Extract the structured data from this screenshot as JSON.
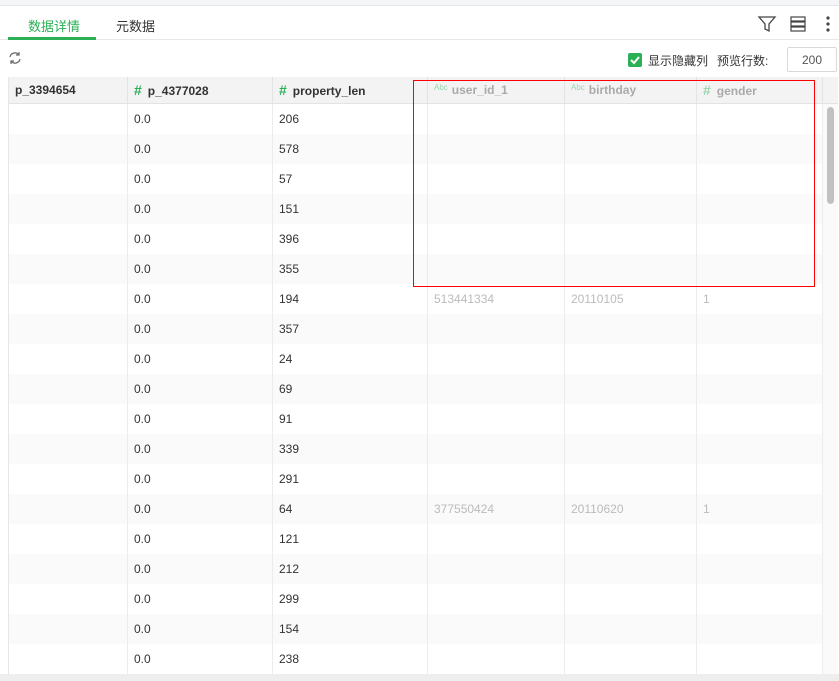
{
  "tabs": [
    {
      "label": "数据详情",
      "active": true
    },
    {
      "label": "元数据",
      "active": false
    }
  ],
  "toolbar": {
    "show_hidden_label": "显示隐藏列",
    "show_hidden_checked": true,
    "preview_rows_label": "预览行数:",
    "preview_rows_value": "200"
  },
  "columns": [
    {
      "name": "p_3394654",
      "type": "",
      "hidden": false
    },
    {
      "name": "p_4377028",
      "type": "#",
      "hidden": false
    },
    {
      "name": "property_len",
      "type": "#",
      "hidden": false
    },
    {
      "name": "user_id_1",
      "type": "Abc",
      "hidden": true
    },
    {
      "name": "birthday",
      "type": "Abc",
      "hidden": true
    },
    {
      "name": "gender",
      "type": "#",
      "hidden": true
    }
  ],
  "rows": [
    [
      "",
      "0.0",
      "206",
      "",
      "",
      ""
    ],
    [
      "",
      "0.0",
      "578",
      "",
      "",
      ""
    ],
    [
      "",
      "0.0",
      "57",
      "",
      "",
      ""
    ],
    [
      "",
      "0.0",
      "151",
      "",
      "",
      ""
    ],
    [
      "",
      "0.0",
      "396",
      "",
      "",
      ""
    ],
    [
      "",
      "0.0",
      "355",
      "",
      "",
      ""
    ],
    [
      "",
      "0.0",
      "194",
      "513441334",
      "20110105",
      "1"
    ],
    [
      "",
      "0.0",
      "357",
      "",
      "",
      ""
    ],
    [
      "",
      "0.0",
      "24",
      "",
      "",
      ""
    ],
    [
      "",
      "0.0",
      "69",
      "",
      "",
      ""
    ],
    [
      "",
      "0.0",
      "91",
      "",
      "",
      ""
    ],
    [
      "",
      "0.0",
      "339",
      "",
      "",
      ""
    ],
    [
      "",
      "0.0",
      "291",
      "",
      "",
      ""
    ],
    [
      "",
      "0.0",
      "64",
      "377550424",
      "20110620",
      "1"
    ],
    [
      "",
      "0.0",
      "121",
      "",
      "",
      ""
    ],
    [
      "",
      "0.0",
      "212",
      "",
      "",
      ""
    ],
    [
      "",
      "0.0",
      "299",
      "",
      "",
      ""
    ],
    [
      "",
      "0.0",
      "154",
      "",
      "",
      ""
    ],
    [
      "",
      "0.0",
      "238",
      "",
      "",
      ""
    ]
  ],
  "colors": {
    "accent": "#2bb056",
    "highlight": "#ff0000"
  }
}
